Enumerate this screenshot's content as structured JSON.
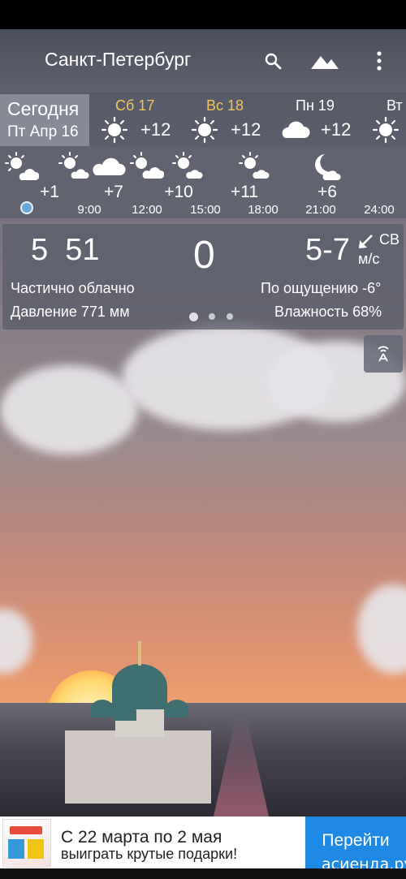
{
  "app": {
    "city": "Санкт-Петербург"
  },
  "daily": {
    "today_label": "Сегодня",
    "today_date": "Пт Апр 16",
    "days": [
      {
        "name": "Сб 17",
        "temp": "+12",
        "icon": "sunny"
      },
      {
        "name": "Вс 18",
        "temp": "+12",
        "icon": "sunny"
      },
      {
        "name": "Пн 19",
        "temp": "+12",
        "icon": "cloudy"
      },
      {
        "name": "Вт",
        "temp": "",
        "icon": "sunny"
      }
    ]
  },
  "hourly": {
    "temps": [
      "+1",
      "+7",
      "+10",
      "+11",
      "+6"
    ],
    "times": [
      "9:00",
      "12:00",
      "15:00",
      "18:00",
      "21:00",
      "24:00"
    ],
    "icons": [
      "partly-cloudy",
      "partly-cloudy",
      "cloudy",
      "partly-cloudy",
      "partly-cloudy",
      "partly-cloudy",
      "moon-partly-cloudy"
    ]
  },
  "current": {
    "time": "5  51",
    "temp": "0",
    "wind_speed": "5-7",
    "wind_dir": "СВ",
    "wind_unit": "м/с",
    "condition": "Частично облачно",
    "feels_like": "По ощущению -6°",
    "pressure": "Давление 771 мм",
    "humidity": "Влажность 68%"
  },
  "ad": {
    "line1": "С 22 марта по 2 мая",
    "line2": "выиграть крутые подарки!",
    "button": "Перейти",
    "watermark": "асиенда.ру"
  },
  "colors": {
    "accent_gold": "#f0c35c",
    "ad_button": "#1e88e5",
    "now_dot": "#6aa8d8"
  }
}
